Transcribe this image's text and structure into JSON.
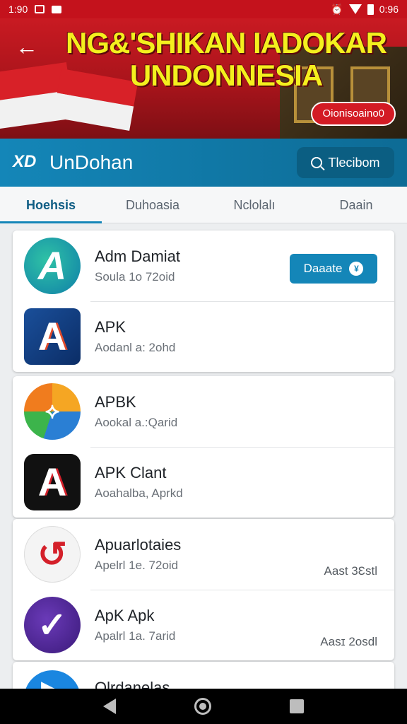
{
  "status_bar": {
    "time": "1:90",
    "time_right": "0:96"
  },
  "banner": {
    "title_line1": "NG&'SHIKAN IADOKAR",
    "title_line2": "UNDONNESIA",
    "pill_label": "Oionisoaino0"
  },
  "header": {
    "logo_text": "XD",
    "app_name": "UnDohan",
    "search_label": "Tlecibom"
  },
  "tabs": [
    {
      "label": "Hoehsis"
    },
    {
      "label": "Duhoasia"
    },
    {
      "label": "Nclolalı"
    },
    {
      "label": "Daain"
    }
  ],
  "cards": [
    {
      "rows": [
        {
          "title": "Adm Damiat",
          "subtitle": "Soula 1o 72oid",
          "action_label": "Daaate",
          "action_icon": "¥"
        },
        {
          "title": "APK",
          "subtitle": "Aodanl a: 2ohd"
        }
      ]
    },
    {
      "rows": [
        {
          "title": "APBK",
          "subtitle": "Aookal a.:Qarid"
        },
        {
          "title": "APK Clant",
          "subtitle": "Aoahalba, Aprkd"
        }
      ]
    },
    {
      "rows": [
        {
          "title": "Apuarlotaies",
          "subtitle": "Apelrl 1e. 72oid",
          "note": "Aast 3Ɛstl"
        },
        {
          "title": "ApK  Apk",
          "subtitle": "Apalrl 1a. 7arid",
          "note": "Aasɪ 2osdl"
        }
      ]
    },
    {
      "rows": [
        {
          "title": "Olrdanelas"
        }
      ]
    }
  ],
  "colors": {
    "banner_red": "#c91a22",
    "banner_text": "#f4f01e",
    "header_blue": "#1486b8",
    "tab_active": "#0f5d84"
  }
}
